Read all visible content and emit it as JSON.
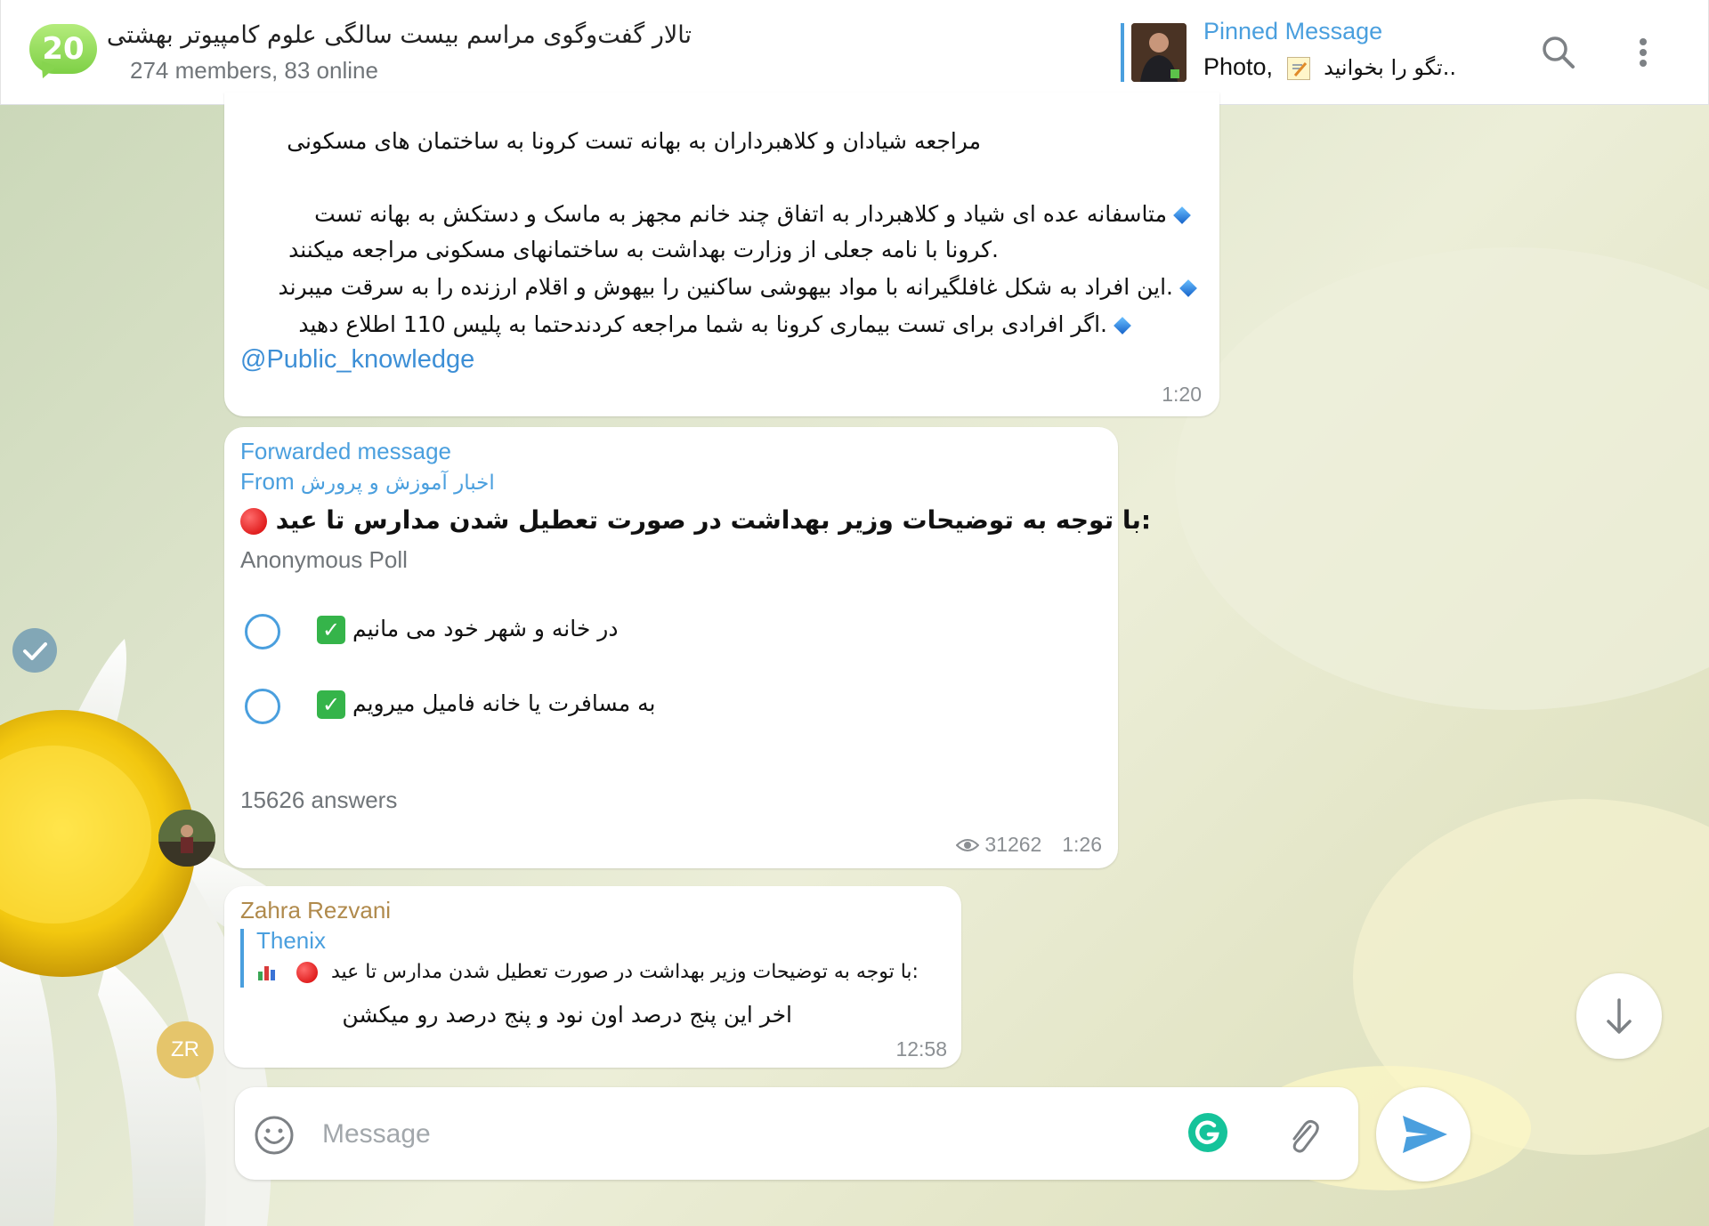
{
  "header": {
    "avatar_text": "20",
    "title": "تالار گفت‌وگوی مراسم بیست سالگی علوم کامپیوتر بهشتی",
    "subtitle": "274 members, 83 online",
    "pinned": {
      "label": "Pinned Message",
      "prefix": "Photo,",
      "text": "..تگو را بخوانید"
    }
  },
  "messages": {
    "m1": {
      "title": "مراجعه شیادان و کلاهبرداران به بهانه تست کرونا به ساختمان های مسکونی",
      "line1": "متاسفانه عده ای شیاد و کلاهبردار به اتفاق چند خانم مجهز به ماسک و دستکش به بهانه تست",
      "line2": ".کرونا با نامه جعلی از وزارت بهداشت به ساختمانهای مسکونی مراجعه میکنند",
      "line3": ".این افراد به شکل غافلگیرانه با مواد بیهوشی ساکنین را بیهوش و اقلام ارزنده را به سرقت میبرند",
      "line4": ".اگر افرادی برای تست بیماری کرونا به شما مراجعه کردندحتما به پلیس 110 اطلاع دهید",
      "link": "@Public_knowledge",
      "time": "1:20"
    },
    "m2": {
      "forwarded_label": "Forwarded message",
      "from_label": "From",
      "from_channel": "اخبار آموزش و پرورش",
      "question": ":با توجه به توضیحات وزیر بهداشت در صورت تعطیل شدن مدارس تا عید",
      "poll_type": "Anonymous Poll",
      "options": [
        {
          "text": "در خانه و شهر خود می مانیم"
        },
        {
          "text": "به مسافرت یا خانه فامیل میرویم"
        }
      ],
      "answers": "15626 answers",
      "views": "31262",
      "time": "1:26"
    },
    "m3": {
      "sender": "Zahra Rezvani",
      "avatar_initials": "ZR",
      "reply_to": "Thenix",
      "reply_text": ":با توجه به توضیحات وزیر بهداشت در صورت تعطیل شدن مدارس تا عید",
      "text": "اخر این پنج درصد اون نود و پنج درصد رو میکشن",
      "time": "12:58"
    }
  },
  "composer": {
    "placeholder": "Message"
  },
  "icons": {
    "search": "search-icon",
    "more": "more-vertical-icon",
    "emoji": "smile-icon",
    "grammarly": "grammarly-icon",
    "attach": "paperclip-icon",
    "send": "send-icon",
    "scroll": "arrow-down-icon",
    "views": "eye-icon"
  },
  "colors": {
    "accent": "#4a9fde",
    "sender": "#b08a4c",
    "online_green": "#7ed046",
    "poll_check": "#35b44a"
  }
}
